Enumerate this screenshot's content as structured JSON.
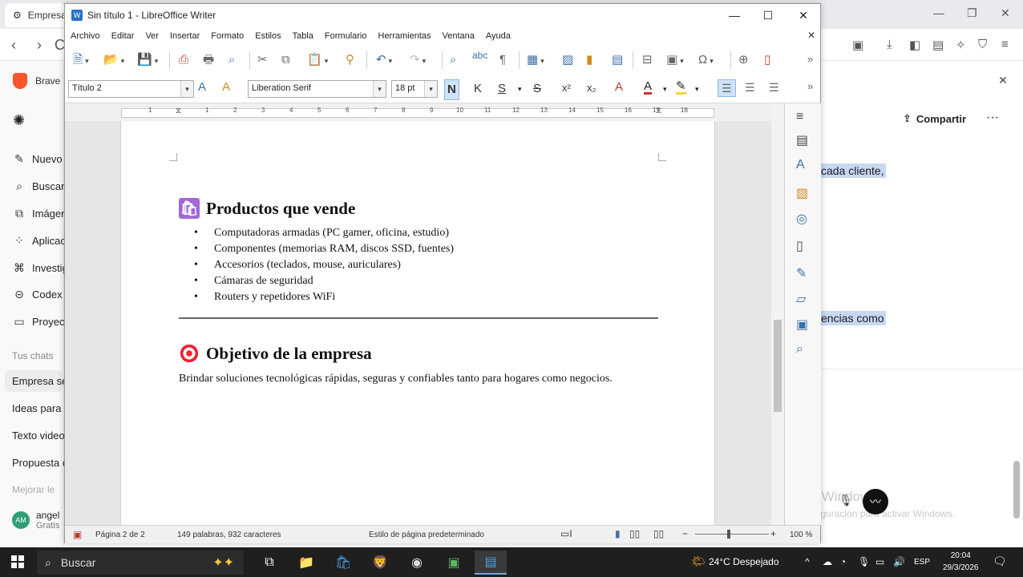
{
  "browser": {
    "tab_title": "Empresa",
    "brand_label": "Brave",
    "sidebar": {
      "items": [
        {
          "label": "Nuevo",
          "icon": "edit-icon"
        },
        {
          "label": "Buscar",
          "icon": "search-icon"
        },
        {
          "label": "Imágen",
          "icon": "image-icon"
        },
        {
          "label": "Aplicac",
          "icon": "apps-icon"
        },
        {
          "label": "Investig",
          "icon": "research-icon"
        },
        {
          "label": "Codex",
          "icon": "codex-icon"
        },
        {
          "label": "Proyect",
          "icon": "folder-icon"
        }
      ],
      "section_title": "Tus chats",
      "chats": [
        "Empresa se",
        "Ideas para",
        "Texto video",
        "Propuesta c"
      ],
      "upgrade": "Mejorar le",
      "user_name": "angel",
      "user_initials": "AM",
      "user_plan": "Gratis"
    },
    "share_label": "Compartir",
    "highlight_1": "cada cliente,",
    "highlight_2": "encias como",
    "watermark_title": "Activar Windows",
    "watermark_sub": "Ve a Configuración para activar Windows."
  },
  "writer": {
    "title": "Sin título 1 - LibreOffice Writer",
    "menu": [
      "Archivo",
      "Editar",
      "Ver",
      "Insertar",
      "Formato",
      "Estilos",
      "Tabla",
      "Formulario",
      "Herramientas",
      "Ventana",
      "Ayuda"
    ],
    "paragraph_style": "Título 2",
    "font_name": "Liberation Serif",
    "font_size": "18 pt",
    "format_buttons": {
      "bold": "N",
      "italic": "K",
      "underline": "S",
      "strike": "S",
      "superscript": "x²",
      "subscript": "x₂"
    },
    "ruler_numbers": [
      "1",
      "1",
      "2",
      "3",
      "4",
      "5",
      "6",
      "7",
      "8",
      "9",
      "10",
      "11",
      "12",
      "13",
      "14",
      "15",
      "16",
      "17",
      "18"
    ],
    "document": {
      "heading_1": "Productos que vende",
      "products": [
        "Computadoras armadas (PC gamer, oficina, estudio)",
        "Componentes (memorias RAM, discos SSD, fuentes)",
        "Accesorios (teclados, mouse, auriculares)",
        "Cámaras de seguridad",
        "Routers y repetidores WiFi"
      ],
      "heading_2": "Objetivo de la empresa",
      "paragraph": "Brindar soluciones tecnológicas rápidas, seguras y confiables tanto para hogares como negocios."
    },
    "status": {
      "page": "Página 2 de 2",
      "words": "149 palabras, 932 caracteres",
      "page_style": "Estilo de página predeterminado",
      "zoom": "100 %"
    }
  },
  "taskbar": {
    "search_placeholder": "Buscar",
    "weather": "24°C  Despejado",
    "language": "ESP",
    "time": "20:04",
    "date": "29/3/2026"
  }
}
